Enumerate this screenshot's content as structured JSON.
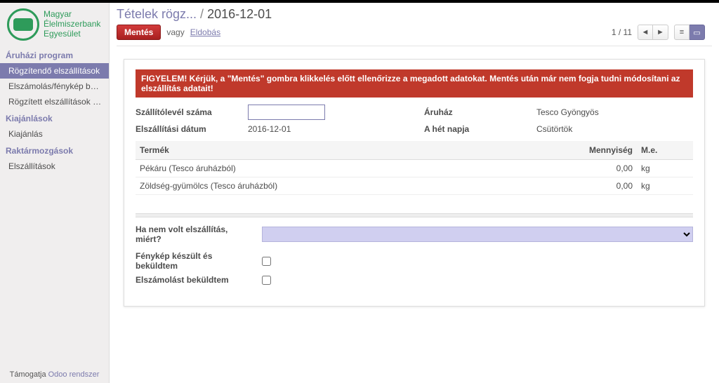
{
  "logo": {
    "line1": "Magyar",
    "line2": "Élelmiszerbank",
    "line3": "Egyesület"
  },
  "nav": {
    "section1": "Áruházi program",
    "items1": [
      "Rögzítendő elszállítások",
      "Elszámolás/fénykép bekül...",
      "Rögzített elszállítások leké..."
    ],
    "section2": "Kiajánlások",
    "items2": [
      "Kiajánlás"
    ],
    "section3": "Raktármozgások",
    "items3": [
      "Elszállítások"
    ]
  },
  "footer": {
    "prefix": "Támogatja ",
    "link": "Odoo rendszer"
  },
  "breadcrumb": {
    "parent": "Tételek rögz...",
    "sep": " / ",
    "current": "2016-12-01"
  },
  "toolbar": {
    "save": "Mentés",
    "or": "vagy",
    "discard": "Eldobás",
    "pager": "1 / 11"
  },
  "alert": "FIGYELEM! Kérjük, a \"Mentés\" gombra klikkelés előtt ellenőrizze a megadott adatokat. Mentés után már nem fogja tudni módosítani az elszállítás adatait!",
  "fields": {
    "delivery_note_label": "Szállítólevél száma",
    "delivery_note_value": "",
    "date_label": "Elszállítási dátum",
    "date_value": "2016-12-01",
    "store_label": "Áruház",
    "store_value": "Tesco Gyöngyös",
    "dow_label": "A hét napja",
    "dow_value": "Csütörtök"
  },
  "table": {
    "headers": {
      "product": "Termék",
      "qty": "Mennyiség",
      "unit": "M.e."
    },
    "rows": [
      {
        "product": "Pékáru (Tesco áruházból)",
        "qty": "0,00",
        "unit": "kg"
      },
      {
        "product": "Zöldség-gyümölcs (Tesco áruházból)",
        "qty": "0,00",
        "unit": "kg"
      }
    ]
  },
  "extra": {
    "no_delivery_label": "Ha nem volt elszállítás, miért?",
    "photo_label": "Fénykép készült és beküldtem",
    "settlement_label": "Elszámolást beküldtem"
  }
}
